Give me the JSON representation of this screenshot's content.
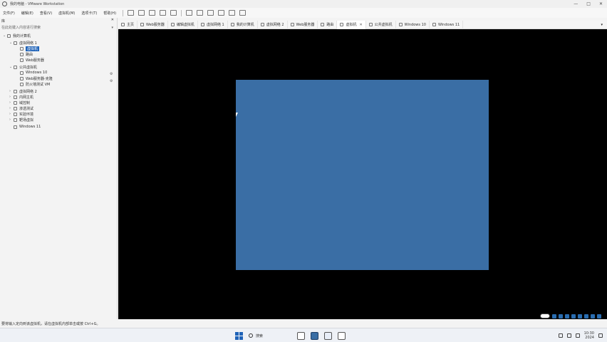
{
  "window": {
    "title": "我的电脑 - VMware Workstation",
    "controls": [
      "—",
      "□",
      "✕"
    ]
  },
  "menu": [
    "文件(F)",
    "编辑(E)",
    "查看(V)",
    "虚拟机(M)",
    "选项卡(T)",
    "帮助(H)"
  ],
  "sidebar": {
    "header": "库",
    "close": "✕",
    "search_placeholder": "在此处键入内容进行搜索",
    "tree": [
      {
        "label": "我的计算机",
        "level": 0,
        "twisty": "⌄"
      },
      {
        "label": "虚拟网络 1",
        "level": 1,
        "twisty": "⌄"
      },
      {
        "label": "虚拟机",
        "level": 2,
        "selected": true
      },
      {
        "label": "路由",
        "level": 2
      },
      {
        "label": "Web服务器",
        "level": 2
      },
      {
        "label": "公共虚拟机",
        "level": 1,
        "twisty": "⌄"
      },
      {
        "label": "Windows 10",
        "level": 2
      },
      {
        "label": "Web服务器-克隆",
        "level": 2
      },
      {
        "label": "防火墙测试 VM",
        "level": 2
      },
      {
        "label": "虚拟网络 2",
        "level": 1,
        "twisty": "›"
      },
      {
        "label": "内网主机",
        "level": 1,
        "twisty": "›"
      },
      {
        "label": "域控制",
        "level": 1,
        "twisty": "›"
      },
      {
        "label": "渗透测试",
        "level": 1,
        "twisty": "›"
      },
      {
        "label": "实验环境",
        "level": 1,
        "twisty": "›"
      },
      {
        "label": "靶场虚拟",
        "level": 1,
        "twisty": "›"
      },
      {
        "label": "Windows 11",
        "level": 1
      }
    ]
  },
  "tabs": [
    {
      "label": "主页"
    },
    {
      "label": "Web服务器"
    },
    {
      "label": "编辑虚拟机"
    },
    {
      "label": "虚拟网络 1"
    },
    {
      "label": "我的计算机"
    },
    {
      "label": "虚拟网络 2"
    },
    {
      "label": "Web服务器"
    },
    {
      "label": "路由"
    },
    {
      "label": "虚拟机",
      "active": true
    },
    {
      "label": "公共虚拟机"
    },
    {
      "label": "Windows 10"
    },
    {
      "label": "Windows 11"
    }
  ],
  "status_bar": "要将输入定向到该虚拟机，请在虚拟机内部单击或按 Ctrl+G。",
  "taskbar": {
    "search_label": "搜索",
    "time": "10:30",
    "date": "2024"
  },
  "colors": {
    "guest_screen": "#3a6ea5",
    "selection": "#1f63b8",
    "vm_background": "#000000"
  }
}
